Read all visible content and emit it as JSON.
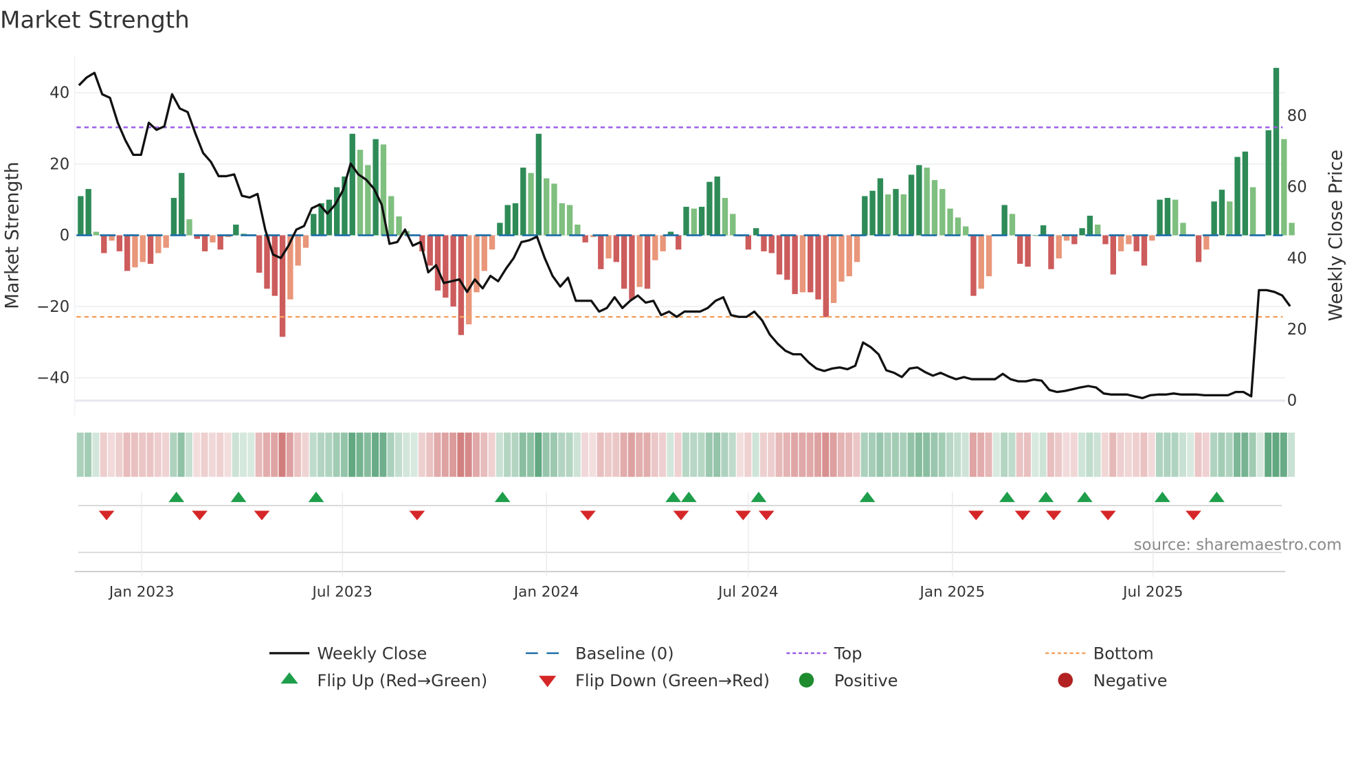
{
  "title": "Market Strength",
  "source": "source: sharemaestro.com",
  "colors": {
    "pos_strong": "#2e8b57",
    "pos_weak": "#7fbf7f",
    "neg_strong": "#cd5c5c",
    "neg_weak": "#e9967a",
    "line": "#111111",
    "baseline": "#1f6fa8",
    "top": "#9b5de5",
    "bottom": "#f4a261",
    "flip_up": "#1e9e4a",
    "flip_down": "#d62728",
    "positive": "#1e8c2e",
    "negative": "#b22222"
  },
  "chart_data": {
    "type": "bar+line",
    "title": "Market Strength",
    "ylabel": "Market Strength",
    "y2label": "Weekly Close Price",
    "x_start": "2022-11-07",
    "x_freq": "weekly",
    "x_ticks": [
      "Jan 2023",
      "Jul 2023",
      "Jan 2024",
      "Jul 2024",
      "Jan 2025",
      "Jul 2025"
    ],
    "x_tick_dates": [
      "2023-01-01",
      "2023-07-01",
      "2024-01-01",
      "2024-07-01",
      "2025-01-01",
      "2025-07-01"
    ],
    "ylim": [
      -50.5,
      50.2
    ],
    "y_ticks": [
      40,
      20,
      0,
      -20,
      -40
    ],
    "y2lim": [
      -4.1,
      96.6
    ],
    "y2_ticks": [
      80,
      60,
      40,
      20,
      0
    ],
    "grid": true,
    "top_level": 30.3,
    "bottom_level": -22.9,
    "strength": [
      11,
      13,
      1,
      -5,
      -1.5,
      -4.5,
      -10,
      -9,
      -7.5,
      -8,
      -5,
      -3.5,
      10.5,
      17.5,
      4.5,
      -1,
      -4.5,
      -2,
      -4,
      -0.5,
      3,
      0.5,
      0,
      -10.5,
      -15,
      -17,
      -28.5,
      -18,
      -8.5,
      -3.5,
      6,
      9,
      10,
      13.5,
      16.5,
      28.5,
      24,
      19.7,
      27,
      25.5,
      11,
      5.3,
      1.2,
      0,
      -4.5,
      -8.5,
      -15.5,
      -17.5,
      -20,
      -28,
      -25,
      -16,
      -10,
      -4,
      3.5,
      8.5,
      9,
      19,
      17.5,
      28.5,
      16,
      14.5,
      9,
      8.5,
      3,
      -2,
      -0.5,
      -9.5,
      -6.5,
      -7.5,
      -15,
      -18,
      -14.5,
      -15,
      -7,
      -4.5,
      1,
      -4,
      8,
      7.5,
      8,
      15,
      16.5,
      10.5,
      6,
      -0.3,
      -4,
      2,
      -4.5,
      -5,
      -11,
      -12.5,
      -16.5,
      -16,
      -16,
      -18,
      -23,
      -19,
      -13,
      -11.5,
      -7.5,
      11,
      12.5,
      16,
      11.5,
      13,
      11.5,
      17,
      19.7,
      19,
      15.5,
      13,
      7.5,
      5,
      2.5,
      -17,
      -15,
      -11.5,
      0,
      8.5,
      6,
      -8,
      -8.8,
      0,
      2.8,
      -9.5,
      -6.5,
      -1.5,
      -2.5,
      2,
      5.5,
      3,
      -2.5,
      -11,
      -4.5,
      -2.5,
      -4.5,
      -8.5,
      -1.5,
      10,
      10.5,
      10,
      3.5,
      0,
      -7.5,
      -4,
      9.5,
      12.8,
      9.5,
      22,
      23.5,
      13.5,
      0,
      29.5,
      47,
      27,
      3.5
    ],
    "weekly_close": [
      88.5,
      90.7,
      92,
      86,
      85,
      78,
      73,
      69,
      69,
      78,
      76,
      77,
      86,
      82,
      81,
      75,
      69.5,
      67,
      63,
      63,
      63.5,
      57.5,
      57,
      58,
      48,
      41,
      40,
      43.5,
      48,
      49,
      54,
      55,
      52.5,
      55,
      59,
      66.5,
      63.5,
      62,
      59.5,
      55,
      44,
      44.5,
      48,
      43.5,
      44.5,
      36,
      38,
      33,
      33.5,
      34,
      30.5,
      34,
      31.5,
      35,
      33.5,
      37,
      40,
      44.5,
      45,
      46,
      40,
      35,
      32,
      34.5,
      28,
      28,
      28,
      25,
      26,
      29,
      26,
      28,
      29.5,
      27.5,
      28,
      24,
      25,
      23.5,
      25,
      25,
      25,
      26,
      28,
      29,
      24,
      23.5,
      23.5,
      25,
      22.5,
      18.5,
      16,
      14,
      13,
      13,
      10.7,
      9,
      8.3,
      9,
      9.3,
      8.8,
      9.8,
      16.3,
      15,
      13,
      8.5,
      7.8,
      6.6,
      9,
      9.3,
      8,
      7,
      7.8,
      6.8,
      6,
      6.6,
      6,
      6,
      6,
      6,
      7.5,
      6,
      5.4,
      5.4,
      5.9,
      5.6,
      3,
      2.4,
      2.7,
      3.2,
      3.7,
      4.1,
      3.7,
      2,
      1.7,
      1.7,
      1.7,
      1.2,
      0.7,
      1.5,
      1.7,
      1.7,
      2,
      1.7,
      1.7,
      1.7,
      1.5,
      1.5,
      1.5,
      1.5,
      2.4,
      2.4,
      1.2,
      31,
      31,
      30.5,
      29.5,
      26.5
    ],
    "flip_up": [
      "2023-01-30",
      "2023-03-27",
      "2023-06-05",
      "2023-11-20",
      "2024-04-22",
      "2024-05-06",
      "2024-07-08",
      "2024-10-14",
      "2025-02-17",
      "2025-03-24",
      "2025-04-28",
      "2025-07-07",
      "2025-08-25"
    ],
    "flip_down": [
      "2022-11-28",
      "2023-02-20",
      "2023-04-17",
      "2023-09-04",
      "2024-02-05",
      "2024-04-29",
      "2024-06-24",
      "2024-07-15",
      "2025-01-20",
      "2025-03-03",
      "2025-03-31",
      "2025-05-19",
      "2025-08-04"
    ],
    "legend": [
      {
        "label": "Weekly Close",
        "symbol": "line"
      },
      {
        "label": "Baseline (0)",
        "symbol": "dash"
      },
      {
        "label": "Top",
        "symbol": "dot-purple"
      },
      {
        "label": "Bottom",
        "symbol": "dot-orange"
      },
      {
        "label": "Flip Up (Red→Green)",
        "symbol": "tri-up"
      },
      {
        "label": "Flip Down (Green→Red)",
        "symbol": "tri-down"
      },
      {
        "label": "Positive",
        "symbol": "circle-green"
      },
      {
        "label": "Negative",
        "symbol": "circle-red"
      }
    ],
    "legend_position": "bottom"
  }
}
